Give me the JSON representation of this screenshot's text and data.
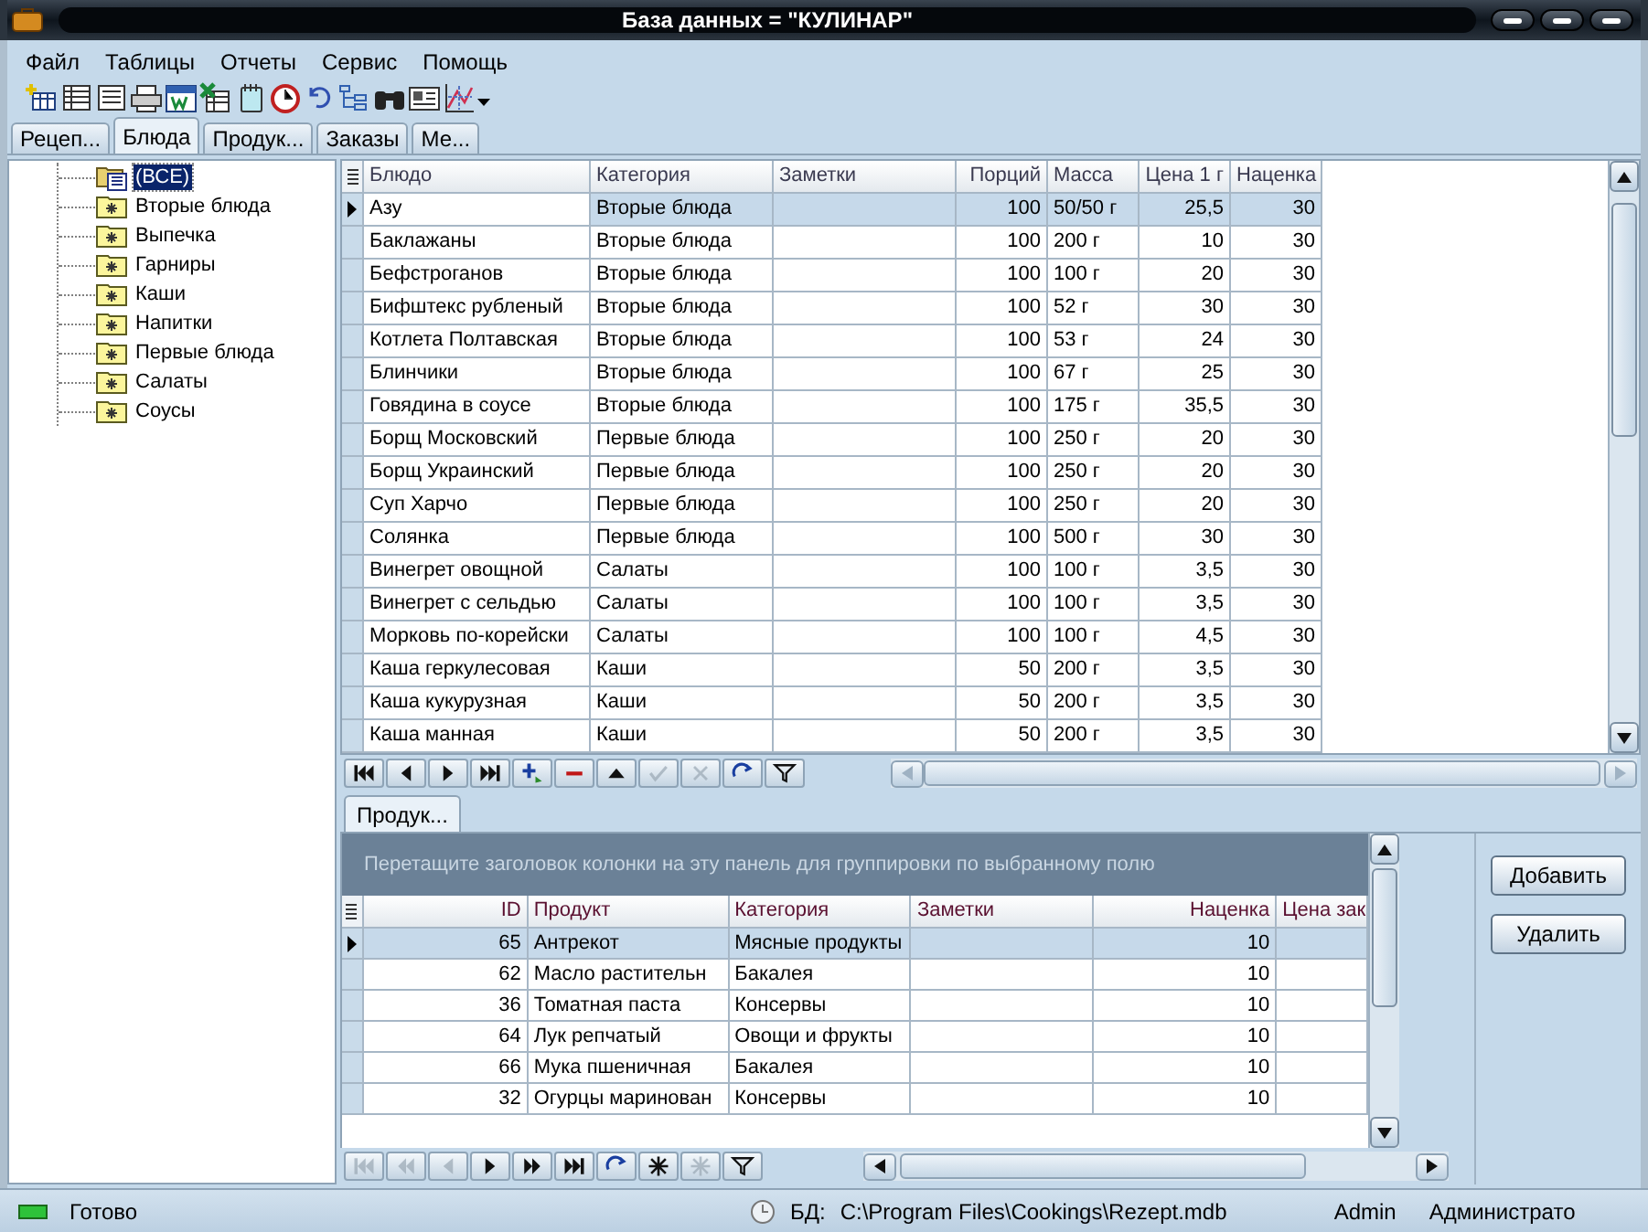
{
  "window": {
    "title": "База данных = \"КУЛИНАР\""
  },
  "menu": [
    "Файл",
    "Таблицы",
    "Отчеты",
    "Сервис",
    "Помощь"
  ],
  "tabs": [
    {
      "label": "Рецеп...",
      "selected": false
    },
    {
      "label": "Блюда",
      "selected": true
    },
    {
      "label": "Продук...",
      "selected": false
    },
    {
      "label": "Заказы",
      "selected": false
    },
    {
      "label": "Ме...",
      "selected": false
    }
  ],
  "tree": {
    "label": "(ВСЕ)",
    "selected": true,
    "children": [
      {
        "label": "Вторые блюда",
        "selected": false
      },
      {
        "label": "Выпечка",
        "selected": false
      },
      {
        "label": "Гарниры",
        "selected": false
      },
      {
        "label": "Каши",
        "selected": false
      },
      {
        "label": "Напитки",
        "selected": false
      },
      {
        "label": "Первые блюда",
        "selected": false
      },
      {
        "label": "Салаты",
        "selected": false
      },
      {
        "label": "Соусы",
        "selected": false
      }
    ]
  },
  "dishes": {
    "columns": [
      "Блюдо",
      "Категория",
      "Заметки",
      "Порций",
      "Масса",
      "Цена 1 г",
      "Наценка"
    ],
    "rows": [
      {
        "selected": true,
        "cells": [
          "Азу",
          "Вторые блюда",
          null,
          "100",
          "50/50 г",
          "25,5",
          "30"
        ]
      },
      {
        "selected": false,
        "cells": [
          "Баклажаны",
          "Вторые блюда",
          null,
          "100",
          "200 г",
          "10",
          "30"
        ]
      },
      {
        "selected": false,
        "cells": [
          "Бефстроганов",
          "Вторые блюда",
          null,
          "100",
          "100 г",
          "20",
          "30"
        ]
      },
      {
        "selected": false,
        "cells": [
          "Бифштекс рубленый",
          "Вторые блюда",
          null,
          "100",
          "52 г",
          "30",
          "30"
        ]
      },
      {
        "selected": false,
        "cells": [
          "Котлета Полтавская",
          "Вторые блюда",
          null,
          "100",
          "53 г",
          "24",
          "30"
        ]
      },
      {
        "selected": false,
        "cells": [
          "Блинчики",
          "Вторые блюда",
          null,
          "100",
          "67 г",
          "25",
          "30"
        ]
      },
      {
        "selected": false,
        "cells": [
          "Говядина в соусе",
          "Вторые блюда",
          null,
          "100",
          "175 г",
          "35,5",
          "30"
        ]
      },
      {
        "selected": false,
        "cells": [
          "Борщ Московский",
          "Первые блюда",
          null,
          "100",
          "250 г",
          "20",
          "30"
        ]
      },
      {
        "selected": false,
        "cells": [
          "Борщ Украинский",
          "Первые блюда",
          null,
          "100",
          "250 г",
          "20",
          "30"
        ]
      },
      {
        "selected": false,
        "cells": [
          "Суп Харчо",
          "Первые блюда",
          null,
          "100",
          "250 г",
          "20",
          "30"
        ]
      },
      {
        "selected": false,
        "cells": [
          "Солянка",
          "Первые блюда",
          null,
          "100",
          "500 г",
          "30",
          "30"
        ]
      },
      {
        "selected": false,
        "cells": [
          "Винегрет овощной",
          "Салаты",
          null,
          "100",
          "100 г",
          "3,5",
          "30"
        ]
      },
      {
        "selected": false,
        "cells": [
          "Винегрет с сельдью",
          "Салаты",
          null,
          "100",
          "100 г",
          "3,5",
          "30"
        ]
      },
      {
        "selected": false,
        "cells": [
          "Морковь по-корейски",
          "Салаты",
          null,
          "100",
          "100 г",
          "4,5",
          "30"
        ]
      },
      {
        "selected": false,
        "cells": [
          "Каша геркулесовая",
          "Каши",
          null,
          "50",
          "200 г",
          "3,5",
          "30"
        ]
      },
      {
        "selected": false,
        "cells": [
          "Каша кукурузная",
          "Каши",
          null,
          "50",
          "200 г",
          "3,5",
          "30"
        ]
      },
      {
        "selected": false,
        "cells": [
          "Каша манная",
          "Каши",
          null,
          "50",
          "200 г",
          "3,5",
          "30"
        ]
      }
    ],
    "navigator": [
      {
        "kind": "first",
        "disabled": false
      },
      {
        "kind": "prev",
        "disabled": false
      },
      {
        "kind": "next",
        "disabled": false
      },
      {
        "kind": "last",
        "disabled": false
      },
      {
        "kind": "insert",
        "disabled": false
      },
      {
        "kind": "delete",
        "disabled": false
      },
      {
        "kind": "edit",
        "disabled": false
      },
      {
        "kind": "post",
        "disabled": true
      },
      {
        "kind": "cancel",
        "disabled": true
      },
      {
        "kind": "refresh",
        "disabled": false
      },
      {
        "kind": "filter",
        "disabled": false
      }
    ]
  },
  "detail_tab": {
    "label": "Продук...",
    "selected": true
  },
  "products": {
    "group_hint": "Перетащите заголовок колонки на эту панель для группировки по выбранному полю",
    "columns": [
      "ID",
      "Продукт",
      "Категория",
      "Заметки",
      "Наценка",
      "Цена зак"
    ],
    "rows": [
      {
        "selected": true,
        "cells": [
          "65",
          "Антрекот",
          "Мясные продукты",
          null,
          "10",
          null
        ]
      },
      {
        "selected": false,
        "cells": [
          "62",
          "Масло растительн",
          "Бакалея",
          null,
          "10",
          null
        ]
      },
      {
        "selected": false,
        "cells": [
          "36",
          "Томатная паста",
          "Консервы",
          null,
          "10",
          null
        ]
      },
      {
        "selected": false,
        "cells": [
          "64",
          "Лук репчатый",
          "Овощи и фрукты",
          null,
          "10",
          null
        ]
      },
      {
        "selected": false,
        "cells": [
          "66",
          "Мука пшеничная",
          "Бакалея",
          null,
          "10",
          null
        ]
      },
      {
        "selected": false,
        "cells": [
          "32",
          "Огурцы маринован",
          "Консервы",
          null,
          "10",
          null
        ]
      }
    ],
    "navigator": [
      {
        "kind": "first",
        "disabled": true
      },
      {
        "kind": "prevpage",
        "disabled": true
      },
      {
        "kind": "prev",
        "disabled": true
      },
      {
        "kind": "next",
        "disabled": false
      },
      {
        "kind": "nextpage",
        "disabled": false
      },
      {
        "kind": "last",
        "disabled": false
      },
      {
        "kind": "refresh",
        "disabled": false
      },
      {
        "kind": "star",
        "disabled": false
      },
      {
        "kind": "star",
        "disabled": true
      },
      {
        "kind": "filter",
        "disabled": false
      }
    ]
  },
  "buttons": [
    "Добавить",
    "Удалить"
  ],
  "status_bar": {
    "state": "Готово",
    "db_label": "БД:",
    "db_path": "C:\\Program Files\\Cookings\\Rezept.mdb",
    "user": "Admin",
    "role": "Администрато"
  }
}
